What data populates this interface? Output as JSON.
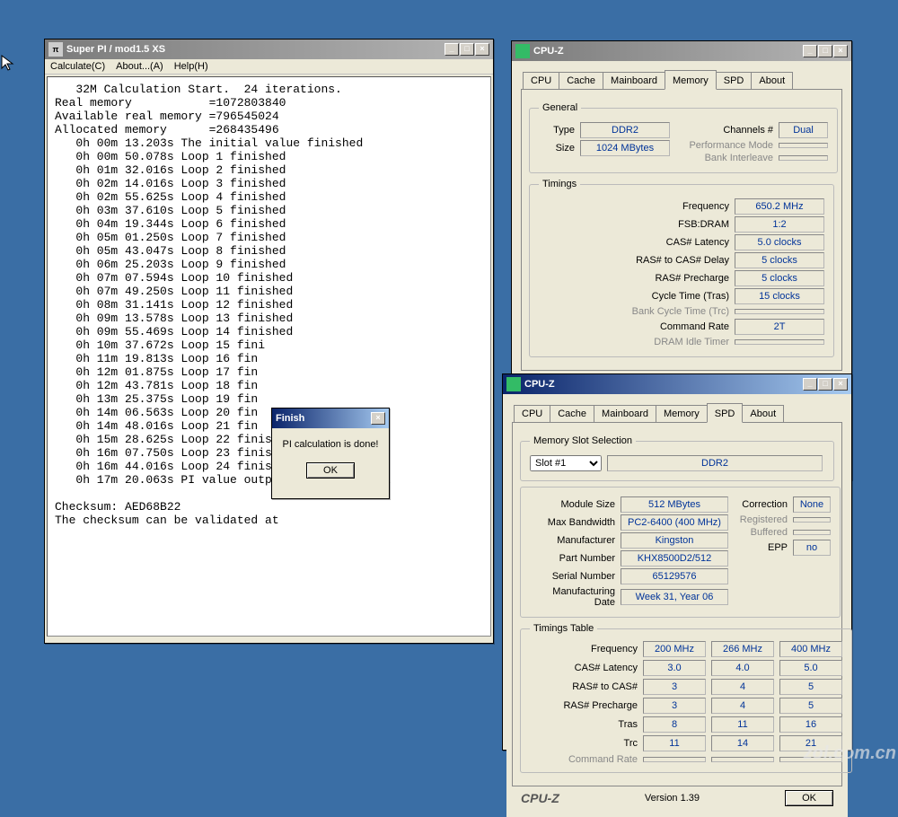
{
  "superpi": {
    "title": "Super PI / mod1.5 XS",
    "menu": {
      "calc": "Calculate(C)",
      "about": "About...(A)",
      "help": "Help(H)"
    },
    "lines": [
      "   32M Calculation Start.  24 iterations.",
      "Real memory           =1072803840",
      "Available real memory =796545024",
      "Allocated memory      =268435496",
      "   0h 00m 13.203s The initial value finished",
      "   0h 00m 50.078s Loop 1 finished",
      "   0h 01m 32.016s Loop 2 finished",
      "   0h 02m 14.016s Loop 3 finished",
      "   0h 02m 55.625s Loop 4 finished",
      "   0h 03m 37.610s Loop 5 finished",
      "   0h 04m 19.344s Loop 6 finished",
      "   0h 05m 01.250s Loop 7 finished",
      "   0h 05m 43.047s Loop 8 finished",
      "   0h 06m 25.203s Loop 9 finished",
      "   0h 07m 07.594s Loop 10 finished",
      "   0h 07m 49.250s Loop 11 finished",
      "   0h 08m 31.141s Loop 12 finished",
      "   0h 09m 13.578s Loop 13 finished",
      "   0h 09m 55.469s Loop 14 finished",
      "   0h 10m 37.672s Loop 15 fini",
      "   0h 11m 19.813s Loop 16 fin",
      "   0h 12m 01.875s Loop 17 fin",
      "   0h 12m 43.781s Loop 18 fin",
      "   0h 13m 25.375s Loop 19 fin",
      "   0h 14m 06.563s Loop 20 fin",
      "   0h 14m 48.016s Loop 21 fin",
      "   0h 15m 28.625s Loop 22 finished",
      "   0h 16m 07.750s Loop 23 finished",
      "   0h 16m 44.016s Loop 24 finished",
      "   0h 17m 20.063s PI value output -> pi_data.txt",
      "",
      "Checksum: AED68B22",
      "The checksum can be validated at"
    ]
  },
  "finish_dialog": {
    "title": "Finish",
    "message": "PI calculation is done!",
    "ok": "OK"
  },
  "cpuz_mem": {
    "title": "CPU-Z",
    "tabs": [
      "CPU",
      "Cache",
      "Mainboard",
      "Memory",
      "SPD",
      "About"
    ],
    "active_tab": "Memory",
    "general": {
      "legend": "General",
      "type_lbl": "Type",
      "type": "DDR2",
      "size_lbl": "Size",
      "size": "1024 MBytes",
      "channels_lbl": "Channels #",
      "channels": "Dual",
      "perf_lbl": "Performance Mode",
      "bank_lbl": "Bank Interleave"
    },
    "timings": {
      "legend": "Timings",
      "rows": [
        {
          "lbl": "Frequency",
          "val": "650.2 MHz"
        },
        {
          "lbl": "FSB:DRAM",
          "val": "1:2"
        },
        {
          "lbl": "CAS# Latency",
          "val": "5.0 clocks"
        },
        {
          "lbl": "RAS# to CAS# Delay",
          "val": "5 clocks"
        },
        {
          "lbl": "RAS# Precharge",
          "val": "5 clocks"
        },
        {
          "lbl": "Cycle Time (Tras)",
          "val": "15 clocks"
        },
        {
          "lbl": "Bank Cycle Time (Trc)",
          "val": "",
          "gray": true
        },
        {
          "lbl": "Command Rate",
          "val": "2T"
        },
        {
          "lbl": "DRAM Idle Timer",
          "val": "",
          "gray": true
        }
      ]
    },
    "version": "1.39",
    "ok": "OK"
  },
  "cpuz_spd": {
    "title": "CPU-Z",
    "tabs": [
      "CPU",
      "Cache",
      "Mainboard",
      "Memory",
      "SPD",
      "About"
    ],
    "active_tab": "SPD",
    "slot_legend": "Memory Slot Selection",
    "slot": "Slot #1",
    "slot_type": "DDR2",
    "rows": [
      {
        "lbl": "Module Size",
        "val": "512 MBytes"
      },
      {
        "lbl": "Max Bandwidth",
        "val": "PC2-6400 (400 MHz)"
      },
      {
        "lbl": "Manufacturer",
        "val": "Kingston"
      },
      {
        "lbl": "Part Number",
        "val": "KHX8500D2/512"
      },
      {
        "lbl": "Serial Number",
        "val": "65129576"
      },
      {
        "lbl": "Manufacturing Date",
        "val": "Week 31, Year 06"
      }
    ],
    "right_rows": [
      {
        "lbl": "Correction",
        "val": "None"
      },
      {
        "lbl": "Registered",
        "val": "",
        "gray": true
      },
      {
        "lbl": "Buffered",
        "val": "",
        "gray": true
      },
      {
        "lbl": "EPP",
        "val": "no"
      }
    ],
    "timings_legend": "Timings Table",
    "timing_headers": [
      "200 MHz",
      "266 MHz",
      "400 MHz"
    ],
    "timing_rows": [
      {
        "lbl": "Frequency"
      },
      {
        "lbl": "CAS# Latency",
        "v": [
          "3.0",
          "4.0",
          "5.0"
        ]
      },
      {
        "lbl": "RAS# to CAS#",
        "v": [
          "3",
          "4",
          "5"
        ]
      },
      {
        "lbl": "RAS# Precharge",
        "v": [
          "3",
          "4",
          "5"
        ]
      },
      {
        "lbl": "Tras",
        "v": [
          "8",
          "11",
          "16"
        ]
      },
      {
        "lbl": "Trc",
        "v": [
          "11",
          "14",
          "21"
        ]
      },
      {
        "lbl": "Command Rate",
        "v": [
          "",
          "",
          ""
        ],
        "gray": true
      }
    ],
    "version_lbl": "Version 1.39",
    "brand": "CPU-Z",
    "ok": "OK"
  },
  "watermark": "zol.com.cn"
}
